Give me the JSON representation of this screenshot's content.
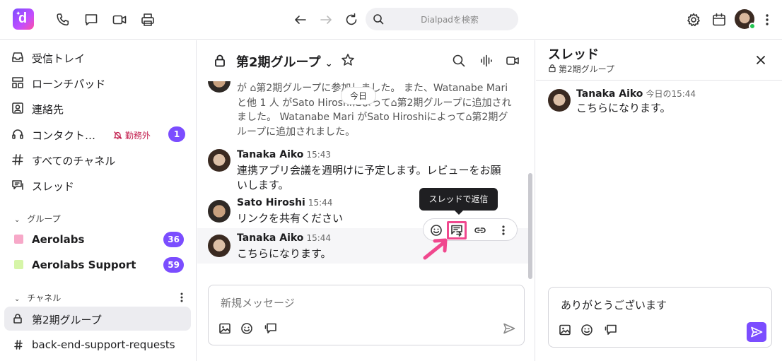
{
  "toolbar": {
    "search_placeholder": "Dialpadを検索",
    "icons": [
      "phone-icon",
      "chat-icon",
      "video-icon",
      "printer-icon",
      "back-arrow-icon",
      "forward-arrow-icon",
      "refresh-icon",
      "settings-icon",
      "calendar-icon",
      "more-vertical-icon"
    ],
    "presence_color": "#23c552"
  },
  "sidebar": {
    "items": [
      {
        "label": "受信トレイ",
        "icon": "inbox-icon"
      },
      {
        "label": "ローンチパッド",
        "icon": "launchpad-icon"
      },
      {
        "label": "連絡先",
        "icon": "contacts-icon"
      },
      {
        "label": "コンタクト…",
        "icon": "headset-icon",
        "status": "勤務外",
        "badge": "1"
      },
      {
        "label": "すべてのチャネル",
        "icon": "hash-icon"
      },
      {
        "label": "スレッド",
        "icon": "thread-icon"
      }
    ],
    "groups_header": "グループ",
    "groups": [
      {
        "label": "Aerolabs",
        "badge": "36",
        "color": "#f7a8c8"
      },
      {
        "label": "Aerolabs Support",
        "badge": "59",
        "color": "#d6f5a8"
      }
    ],
    "channels_header": "チャネル",
    "channels": [
      {
        "label": "第2期グループ",
        "icon": "lock-icon",
        "active": true
      },
      {
        "label": "back-end-support-requests",
        "icon": "hash-icon"
      }
    ],
    "accent": "#7b4dff"
  },
  "channel": {
    "title": "第2期グループ",
    "date_label": "今日",
    "system_text": "が ⌂第2期グループに参加しました。 また、Watanabe Mariと他 1 人 がSato Hiroshiによって⌂第2期グループに追加されました。 Watanabe Mari がSato Hiroshiによって⌂第2期グループに追加されました。",
    "messages": [
      {
        "author": "Tanaka Aiko",
        "time": "15:43",
        "text": "連携アプリ会議を週明けに予定します。レビューをお願いします。"
      },
      {
        "author": "Sato Hiroshi",
        "time": "15:44",
        "text": "リンクを共有ください"
      },
      {
        "author": "Tanaka Aiko",
        "time": "15:44",
        "text": "こちらになります。"
      }
    ],
    "tooltip": "スレッドで返信",
    "composer_placeholder": "新規メッセージ",
    "highlight_color": "#f0488e"
  },
  "thread": {
    "title": "スレッド",
    "subtitle": "第2期グループ",
    "message": {
      "author": "Tanaka Aiko",
      "time": "今日の15:44",
      "text": "こちらになります。"
    },
    "composer_value": "ありがとうございます"
  }
}
